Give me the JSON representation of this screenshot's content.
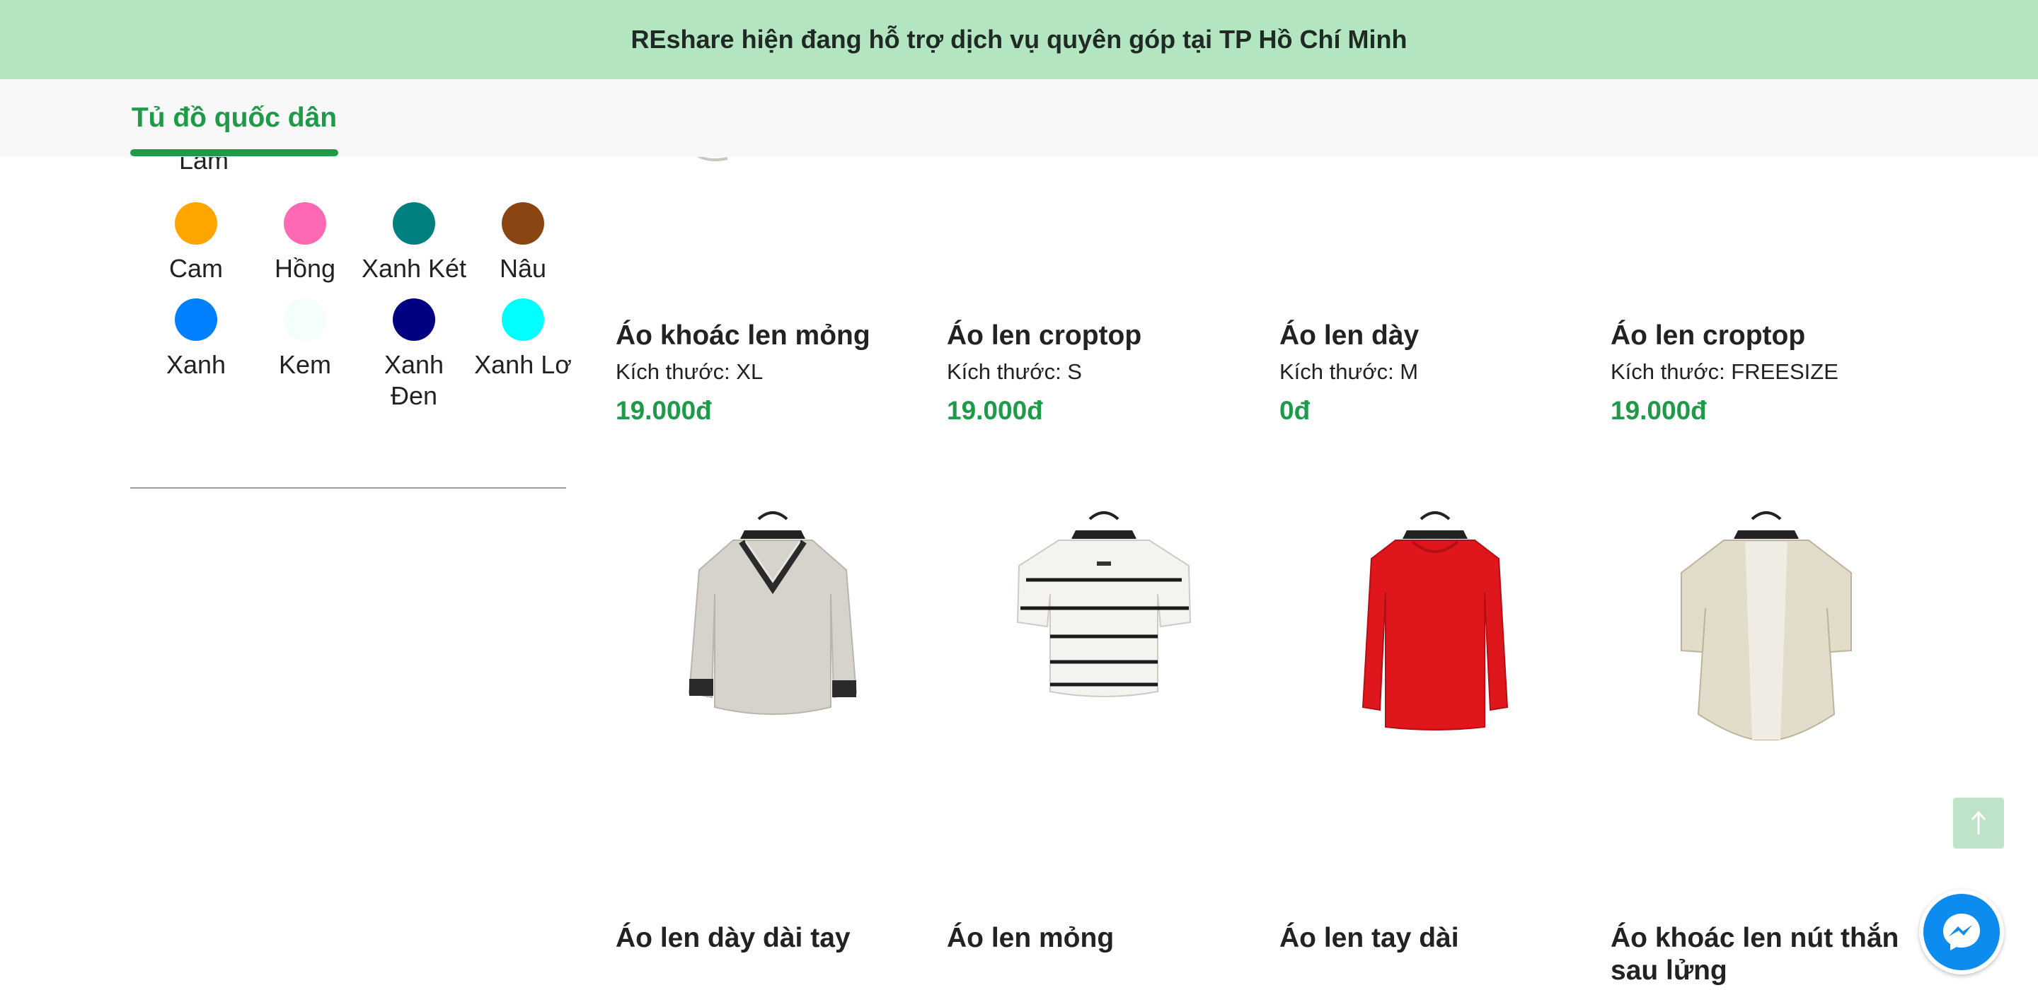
{
  "banner": {
    "text": "REshare hiện đang hỗ trợ dịch vụ quyên góp tại TP Hồ Chí Minh"
  },
  "nav": {
    "tab_label": "Tủ đồ quốc dân"
  },
  "filter": {
    "cut_label": "Lam",
    "colors": [
      {
        "label": "Cam",
        "hex": "#FFA500"
      },
      {
        "label": "Hồng",
        "hex": "#FF69B4"
      },
      {
        "label": "Xanh Két",
        "hex": "#008080"
      },
      {
        "label": "Nâu",
        "hex": "#8B4513"
      },
      {
        "label": "Xanh",
        "hex": "#0080FF"
      },
      {
        "label": "Kem",
        "hex": "#F5FFFA"
      },
      {
        "label": "Xanh Đen",
        "hex": "#000080"
      },
      {
        "label": "Xanh Lơ",
        "hex": "#00FFFF"
      }
    ]
  },
  "products_top": [
    {
      "title": "Áo khoác len mỏng",
      "size": "Kích thước: XL",
      "price": "19.000đ"
    },
    {
      "title": "Áo len croptop",
      "size": "Kích thước: S",
      "price": "19.000đ"
    },
    {
      "title": "Áo len dày",
      "size": "Kích thước: M",
      "price": "0đ"
    },
    {
      "title": "Áo len croptop",
      "size": "Kích thước: FREESIZE",
      "price": "19.000đ"
    }
  ],
  "products_bottom": [
    {
      "title": "Áo len dày dài tay",
      "image": "grey-v-neck-sweater"
    },
    {
      "title": "Áo len mỏng",
      "image": "white-striped-short-sleeve-sweater"
    },
    {
      "title": "Áo len tay dài",
      "image": "red-long-sleeve-sweater"
    },
    {
      "title": "Áo khoác len nút thắn sau lửng",
      "image": "cream-lace-cardigan"
    }
  ],
  "icons": {
    "to_top": "arrow-up-icon",
    "messenger": "messenger-icon"
  }
}
